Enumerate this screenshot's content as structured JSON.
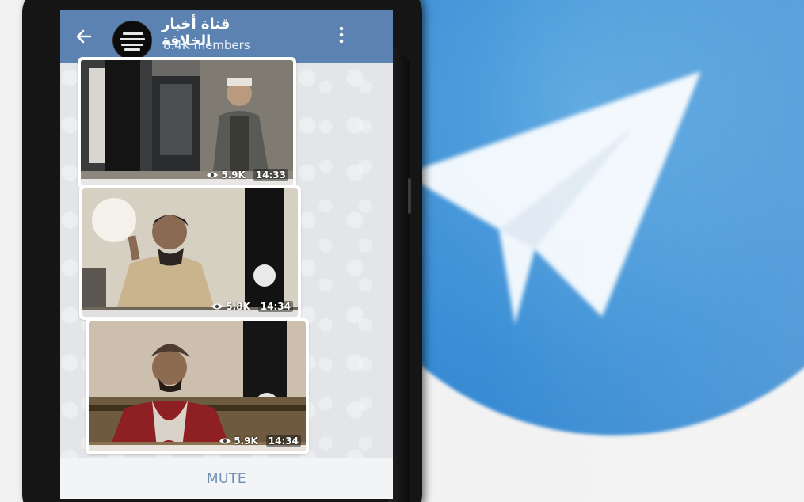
{
  "channel": {
    "title": "قناة أخبار الخلافة",
    "members": "8.4K members"
  },
  "posts": [
    {
      "views": "5.9K",
      "time": "14:33"
    },
    {
      "views": "5.8K",
      "time": "14:34"
    },
    {
      "views": "5.9K",
      "time": "14:34"
    }
  ],
  "footer": {
    "mute_label": "MUTE"
  },
  "icons": {
    "back": "arrow-left-icon",
    "menu": "vertical-dots-icon",
    "views": "eye-icon",
    "background_logo": "telegram-logo"
  },
  "colors": {
    "header": "#5b82b0",
    "mute_text": "#6d8fb6",
    "telegram_blue": "#3b8fd6"
  }
}
